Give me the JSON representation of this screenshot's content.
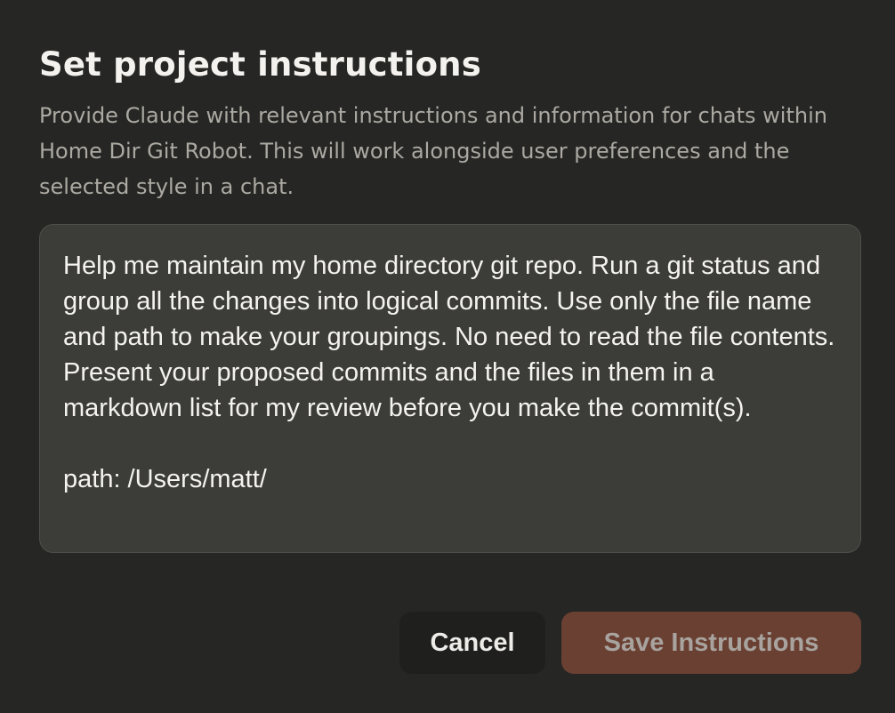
{
  "dialog": {
    "title": "Set project instructions",
    "description": "Provide Claude with relevant instructions and information for chats within Home Dir Git Robot. This will work alongside user preferences and the selected style in a chat.",
    "instructions_value": "Help me maintain my home directory git repo. Run a git status and group all the changes into logical commits. Use only the file name and path to make your groupings. No need to read the file contents. Present your proposed commits and the files in them in a markdown list for my review before you make the commit(s).\n\npath: /Users/matt/",
    "cancel_label": "Cancel",
    "save_label": "Save Instructions"
  },
  "colors": {
    "background": "#262624",
    "textarea_background": "#3C3C38",
    "save_button_disabled": "#6A4032",
    "cancel_button": "#1F1F1D"
  }
}
